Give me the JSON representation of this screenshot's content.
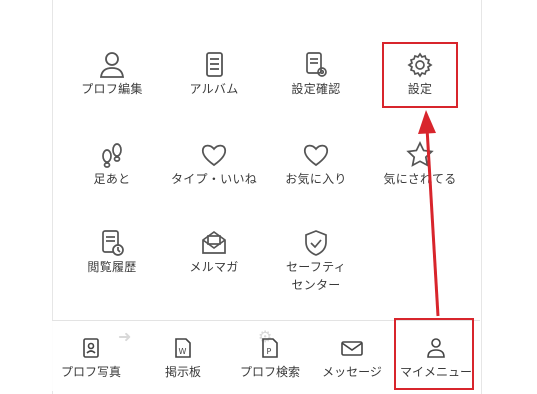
{
  "menu": {
    "items": [
      {
        "label": "プロフ編集",
        "icon": "person-icon"
      },
      {
        "label": "アルバム",
        "icon": "album-icon"
      },
      {
        "label": "設定確認",
        "icon": "settings-check-icon"
      },
      {
        "label": "設定",
        "icon": "gear-icon"
      },
      {
        "label": "足あと",
        "icon": "footprints-icon"
      },
      {
        "label": "タイプ・いいね",
        "icon": "heart-icon"
      },
      {
        "label": "お気に入り",
        "icon": "heart-outline-icon"
      },
      {
        "label": "気にされてる",
        "icon": "star-icon"
      },
      {
        "label": "閲覧履歴",
        "icon": "history-icon"
      },
      {
        "label": "メルマガ",
        "icon": "mail-open-icon"
      },
      {
        "label": "セーフティセンター",
        "icon": "shield-check-icon"
      }
    ]
  },
  "bottom_nav": {
    "items": [
      {
        "label": "プロフ写真",
        "icon": "id-card-icon"
      },
      {
        "label": "掲示板",
        "icon": "board-icon"
      },
      {
        "label": "プロフ検索",
        "icon": "profile-search-icon"
      },
      {
        "label": "メッセージ",
        "icon": "envelope-icon"
      },
      {
        "label": "マイメニュー",
        "icon": "person-icon"
      }
    ]
  },
  "annotation": {
    "color": "#d8252c"
  }
}
